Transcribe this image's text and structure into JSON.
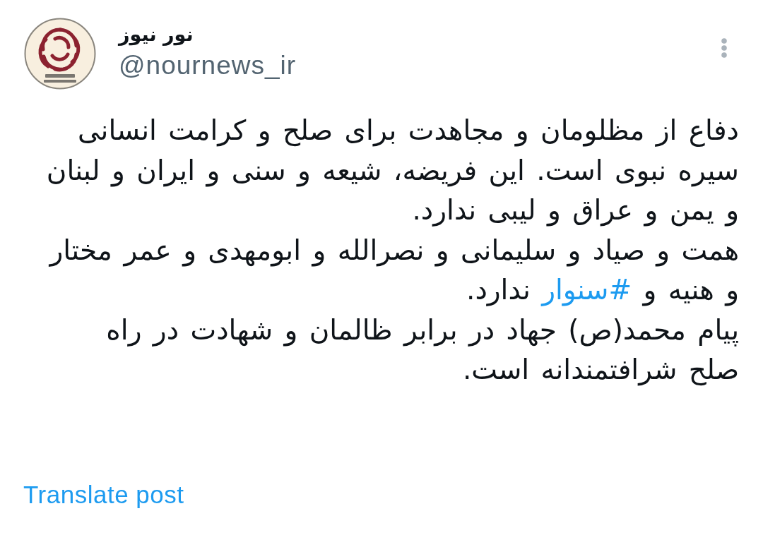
{
  "post": {
    "author": {
      "name": "نور نیوز",
      "handle": "@nournews_ir"
    },
    "body": {
      "lines": [
        {
          "segments": [
            {
              "kind": "text",
              "text": "دفاع از مظلومان و مجاهدت برای صلح و کرامت انسانی"
            }
          ]
        },
        {
          "segments": [
            {
              "kind": "text",
              "text": "سیره نبوی است. این فریضه، شیعه و سنی و ایران و لبنان"
            }
          ]
        },
        {
          "segments": [
            {
              "kind": "text",
              "text": "و یمن و عراق و لیبی ندارد."
            }
          ]
        },
        {
          "segments": [
            {
              "kind": "text",
              "text": "همت و صیاد و سلیمانی و نصرالله و ابومهدی و عمر مختار"
            }
          ]
        },
        {
          "segments": [
            {
              "kind": "text",
              "text": "و هنیه و "
            },
            {
              "kind": "hashtag",
              "text": "#سنوار"
            },
            {
              "kind": "text",
              "text": " ندارد."
            }
          ]
        },
        {
          "segments": [
            {
              "kind": "text",
              "text": "پیام محمد(ص) جهاد در برابر ظالمان و شهادت در راه"
            }
          ]
        },
        {
          "segments": [
            {
              "kind": "text",
              "text": "صلح شرافتمندانه است."
            }
          ]
        }
      ]
    },
    "translate_link": "Translate post"
  }
}
